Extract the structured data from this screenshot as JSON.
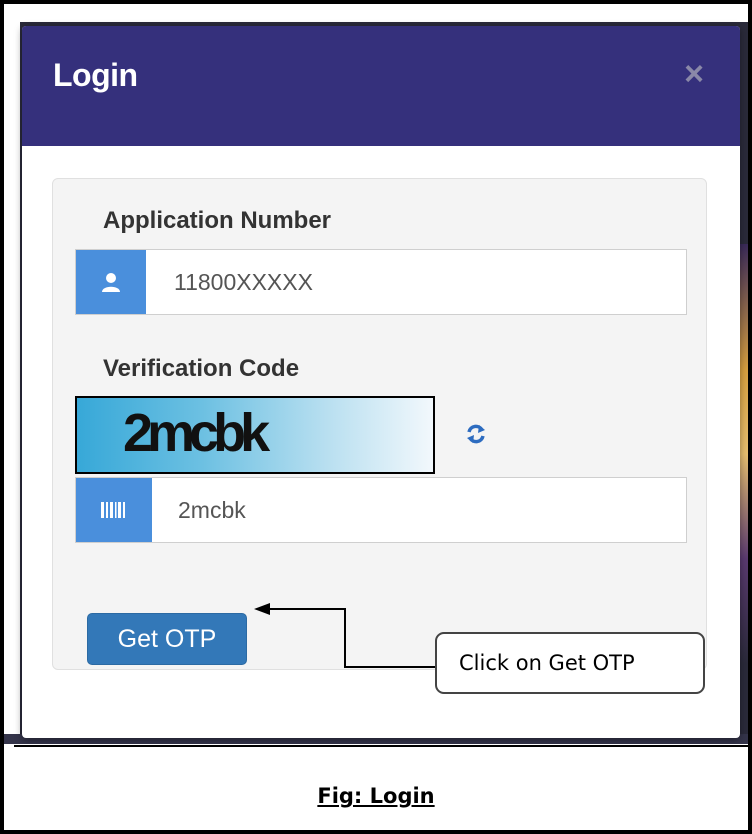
{
  "modal": {
    "title": "Login",
    "close_symbol": "×"
  },
  "form": {
    "application_number": {
      "label": "Application Number",
      "icon": "user-icon",
      "value": "11800XXXXX"
    },
    "verification_code": {
      "label": "Verification Code",
      "captcha_text": "2mcbk",
      "refresh_icon": "refresh-icon",
      "icon": "barcode-icon",
      "value": "2mcbk"
    },
    "submit_label": "Get OTP"
  },
  "annotation": {
    "callout_text": "Click on Get OTP"
  },
  "caption": "Fig: Login",
  "colors": {
    "header": "#35307c",
    "addon": "#4a8fdc",
    "button": "#3378b8",
    "refresh": "#2d6cc0"
  }
}
